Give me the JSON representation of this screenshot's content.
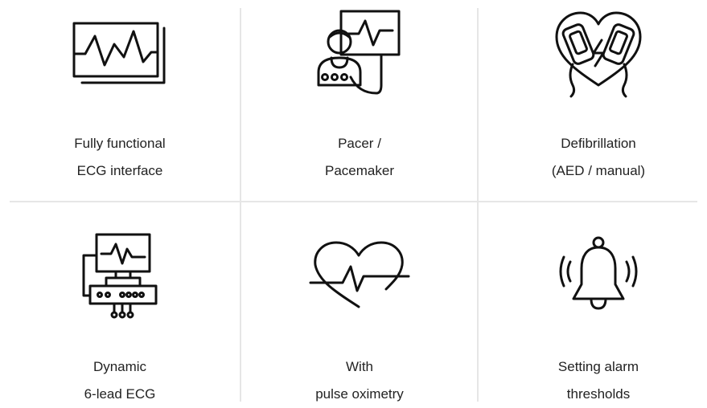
{
  "features": [
    {
      "line1": "Fully functional",
      "line2": "ECG interface",
      "icon": "ecg-monitor-icon"
    },
    {
      "line1": "Pacer /",
      "line2": "Pacemaker",
      "icon": "pacer-patient-icon"
    },
    {
      "line1": "Defibrillation",
      "line2": "(AED / manual)",
      "icon": "defibrillator-heart-icon"
    },
    {
      "line1": "Dynamic",
      "line2": "6-lead ECG",
      "icon": "ecg-device-icon"
    },
    {
      "line1": "With",
      "line2": "pulse oximetry",
      "icon": "heartbeat-icon"
    },
    {
      "line1": "Setting alarm",
      "line2": "thresholds",
      "icon": "alarm-bell-icon"
    }
  ]
}
